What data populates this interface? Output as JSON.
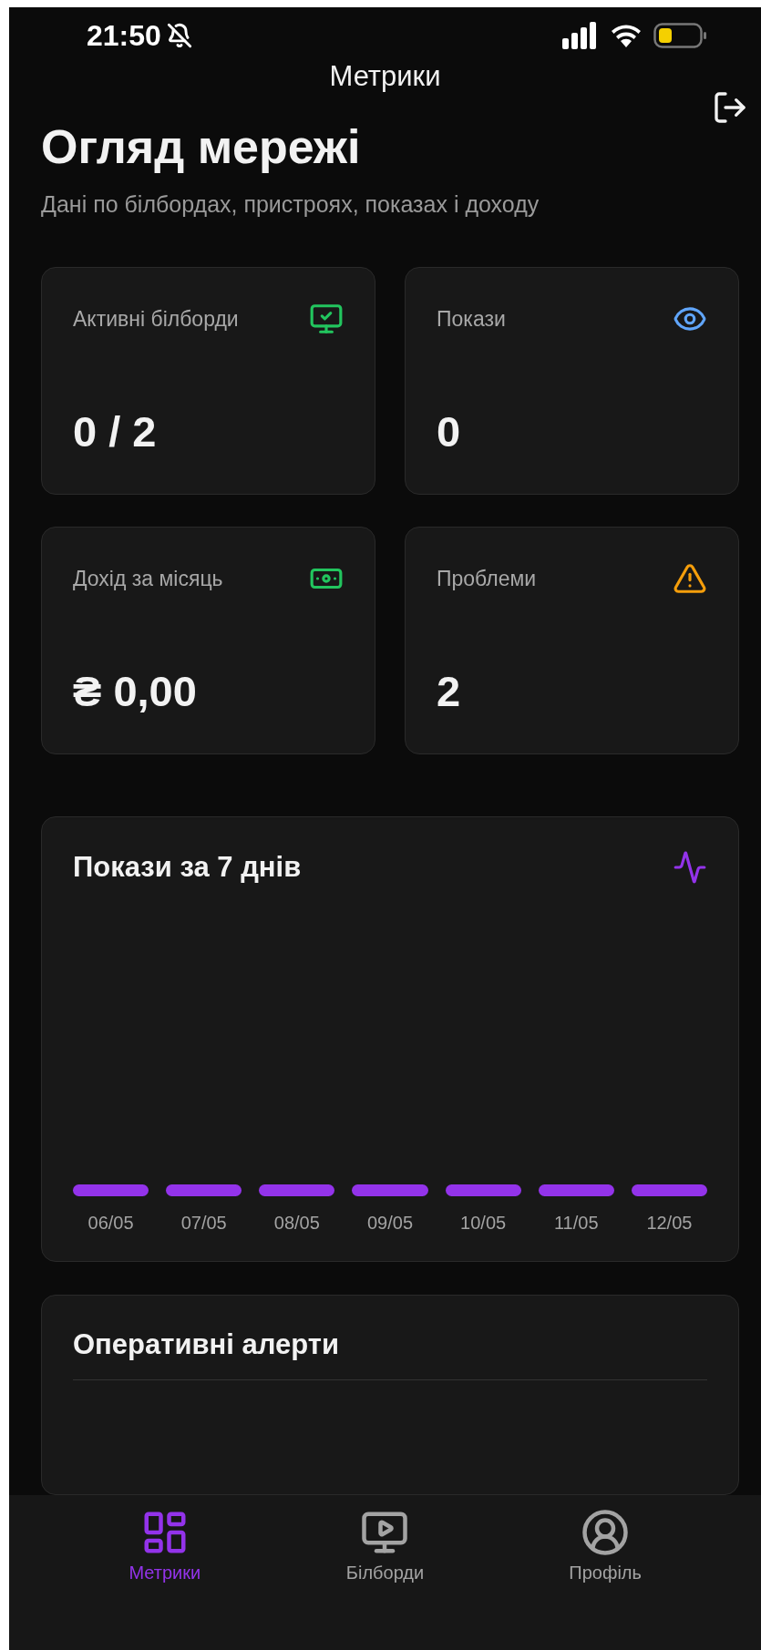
{
  "status_bar": {
    "time": "21:50"
  },
  "header": {
    "title": "Метрики"
  },
  "overview": {
    "title": "Огляд мережі",
    "subtitle": "Дані по білбордах, пристроях, показах і доходу"
  },
  "stats": [
    {
      "kind": "billboards",
      "label": "Активні білборди",
      "value": "0 / 2",
      "color": "#22c55e"
    },
    {
      "kind": "impressions",
      "label": "Покази",
      "value": "0",
      "color": "#60a5fa"
    },
    {
      "kind": "revenue",
      "label": "Дохід за місяць",
      "value": "₴ 0,00",
      "color": "#22c55e"
    },
    {
      "kind": "issues",
      "label": "Проблеми",
      "value": "2",
      "color": "#f59e0b"
    }
  ],
  "impressions_chart": {
    "title": "Покази за 7 днів",
    "days": [
      "06/05",
      "07/05",
      "08/05",
      "09/05",
      "10/05",
      "11/05",
      "12/05"
    ]
  },
  "alerts": {
    "title": "Оперативні алерти"
  },
  "tab_bar": [
    {
      "kind": "metrics",
      "label": "Метрики",
      "selected": true
    },
    {
      "kind": "billboards",
      "label": "Білборди",
      "selected": false
    },
    {
      "kind": "profile",
      "label": "Профіль",
      "selected": false
    }
  ]
}
